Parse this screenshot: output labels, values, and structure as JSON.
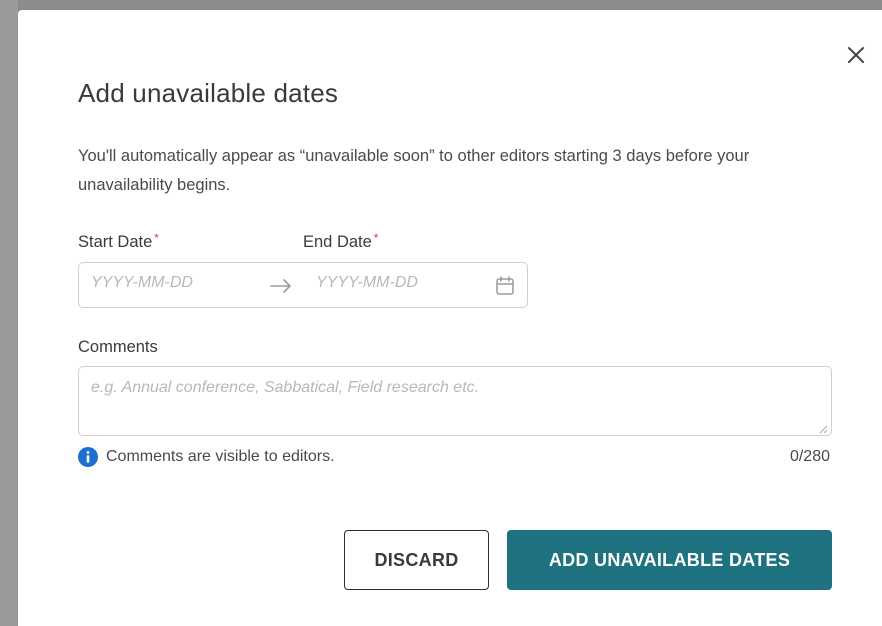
{
  "dialog": {
    "title": "Add unavailable dates",
    "description": "You'll automatically appear as “unavailable soon” to other editors starting 3 days before your unavailability begins.",
    "close_icon": "close-icon"
  },
  "start_date": {
    "label": "Start Date",
    "required_marker": "*",
    "placeholder": "YYYY-MM-DD",
    "value": ""
  },
  "end_date": {
    "label": "End Date",
    "required_marker": "*",
    "placeholder": "YYYY-MM-DD",
    "value": ""
  },
  "date_range_icons": {
    "separator": "arrow-right-icon",
    "picker": "calendar-icon"
  },
  "comments": {
    "label": "Comments",
    "placeholder": "e.g. Annual conference, Sabbatical, Field research etc.",
    "value": "",
    "info_text": "Comments are visible to editors.",
    "counter": "0/280"
  },
  "actions": {
    "discard_label": "DISCARD",
    "submit_label": "ADD UNAVAILABLE DATES"
  },
  "colors": {
    "primary": "#1f7280",
    "required": "#d9434b",
    "info": "#1f6fd1"
  }
}
